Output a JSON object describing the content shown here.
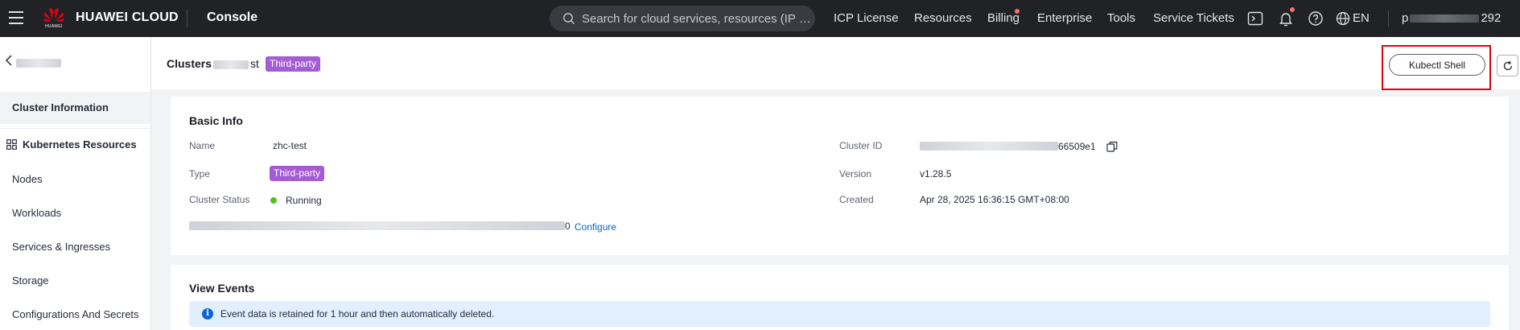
{
  "topbar": {
    "brand": "HUAWEI CLOUD",
    "logo_text": "HUAWEI",
    "console": "Console",
    "search_placeholder": "Search for cloud services, resources (IP ad...",
    "nav": [
      "ICP License",
      "Resources",
      "Billing",
      "Enterprise",
      "Tools",
      "Service Tickets"
    ],
    "lang": "EN",
    "account_prefix": "p",
    "account_suffix": "292"
  },
  "sidebar": {
    "items": [
      "Cluster Information",
      "Kubernetes Resources",
      "Nodes",
      "Workloads",
      "Services & Ingresses",
      "Storage",
      "Configurations And Secrets"
    ]
  },
  "header": {
    "breadcrumb": "Clusters",
    "crumb_suffix": "st",
    "tag": "Third-party",
    "kubectl": "Kubectl Shell"
  },
  "basic_info": {
    "title": "Basic Info",
    "name_label": "Name",
    "name_value": "zhc-test",
    "type_label": "Type",
    "type_value": "Third-party",
    "status_label": "Cluster Status",
    "status_value": "Running",
    "cluster_id_label": "Cluster ID",
    "cluster_id_suffix": "66509e1",
    "version_label": "Version",
    "version_value": "v1.28.5",
    "created_label": "Created",
    "created_value": "Apr 28, 2025 16:36:15 GMT+08:00",
    "row4_suffix": "0",
    "configure": "Configure"
  },
  "events": {
    "title": "View Events",
    "notice": "Event data is retained for 1 hour and then automatically deleted."
  },
  "colors": {
    "topbar": "#202226",
    "tag": "#a45bd6",
    "link": "#0066cc",
    "running": "#52c41a",
    "highlight": "#e0000a"
  }
}
